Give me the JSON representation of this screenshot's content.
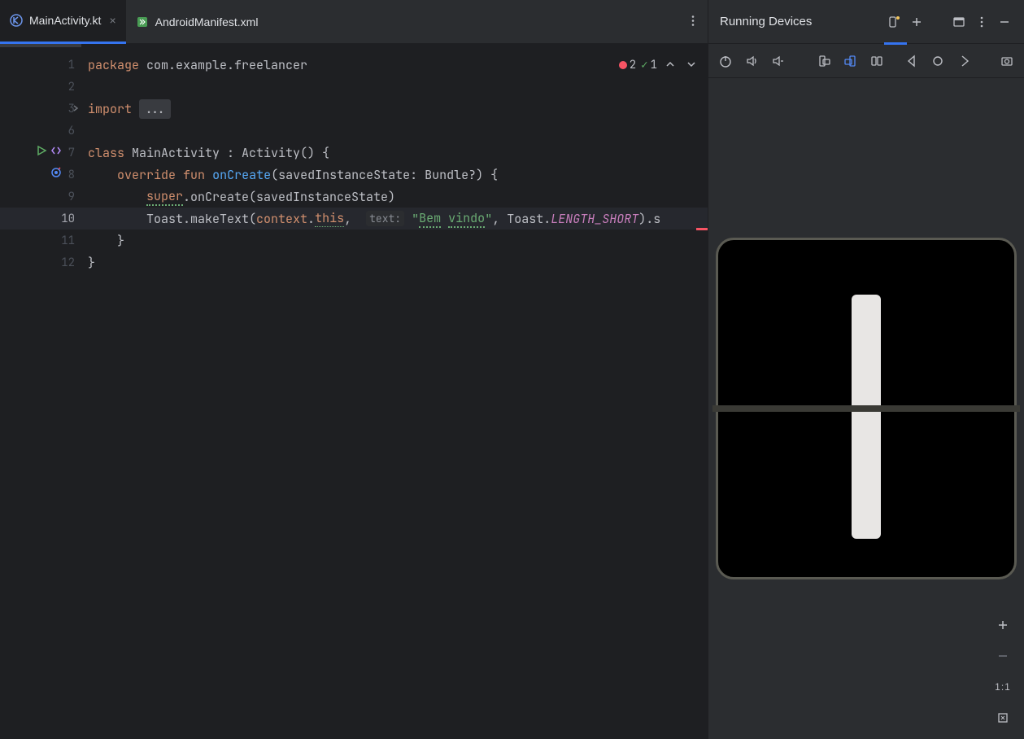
{
  "tabs": [
    {
      "label": "MainActivity.kt",
      "active": true,
      "icon": "kt"
    },
    {
      "label": "AndroidManifest.xml",
      "active": false,
      "icon": "xml"
    }
  ],
  "status": {
    "errors": "2",
    "warnings": "1"
  },
  "gutter_lines": [
    "1",
    "2",
    "3",
    "6",
    "7",
    "8",
    "9",
    "10",
    "11",
    "12"
  ],
  "code": {
    "l1_kw": "package",
    "l1_pkg": " com.example.freelancer",
    "l3_kw": "import",
    "l3_fold": "...",
    "l7_kw": "class",
    "l7_cls": " MainActivity : Activity() {",
    "l8_kw1": "override",
    "l8_kw2": "fun",
    "l8_fn": "onCreate",
    "l8_rest": "(savedInstanceState: Bundle?) {",
    "l9_kw": "super",
    "l9_rest": ".onCreate(savedInstanceState)",
    "l10_a": "Toast.makeText(",
    "l10_ctx": "context",
    "l10_dot": ".",
    "l10_this": "this",
    "l10_comma": ",",
    "l10_hint": "text:",
    "l10_str_open": " \"",
    "l10_str1": "Bem",
    "l10_str_sp": " ",
    "l10_str2": "vindo",
    "l10_str_close": "\"",
    "l10_b": ", Toast.",
    "l10_const": "LENGTH_SHORT",
    "l10_c": ").s",
    "l11_brace": "}",
    "l12_brace": "}"
  },
  "device_panel": {
    "title": "Running Devices",
    "zoom_ratio": "1:1"
  },
  "icons": {
    "run_gutter": "run-icon",
    "code_gutter": "code-icon",
    "target_gutter": "target-icon"
  }
}
